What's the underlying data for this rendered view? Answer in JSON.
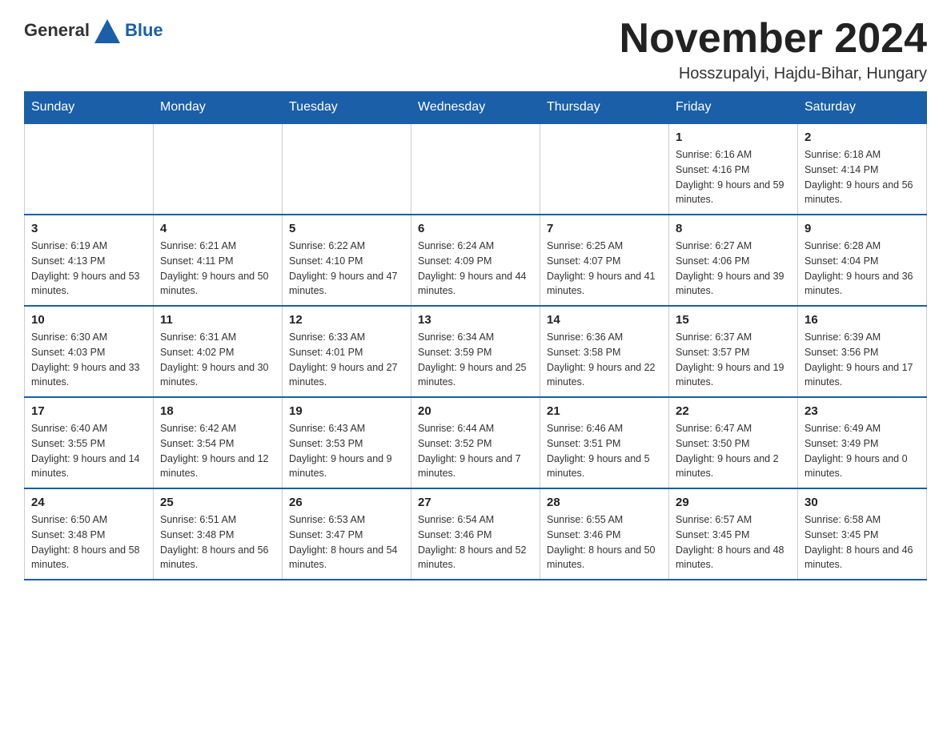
{
  "header": {
    "logo_general": "General",
    "logo_blue": "Blue",
    "month_title": "November 2024",
    "location": "Hosszupalyi, Hajdu-Bihar, Hungary"
  },
  "weekdays": [
    "Sunday",
    "Monday",
    "Tuesday",
    "Wednesday",
    "Thursday",
    "Friday",
    "Saturday"
  ],
  "weeks": [
    [
      {
        "day": "",
        "info": ""
      },
      {
        "day": "",
        "info": ""
      },
      {
        "day": "",
        "info": ""
      },
      {
        "day": "",
        "info": ""
      },
      {
        "day": "",
        "info": ""
      },
      {
        "day": "1",
        "info": "Sunrise: 6:16 AM\nSunset: 4:16 PM\nDaylight: 9 hours and 59 minutes."
      },
      {
        "day": "2",
        "info": "Sunrise: 6:18 AM\nSunset: 4:14 PM\nDaylight: 9 hours and 56 minutes."
      }
    ],
    [
      {
        "day": "3",
        "info": "Sunrise: 6:19 AM\nSunset: 4:13 PM\nDaylight: 9 hours and 53 minutes."
      },
      {
        "day": "4",
        "info": "Sunrise: 6:21 AM\nSunset: 4:11 PM\nDaylight: 9 hours and 50 minutes."
      },
      {
        "day": "5",
        "info": "Sunrise: 6:22 AM\nSunset: 4:10 PM\nDaylight: 9 hours and 47 minutes."
      },
      {
        "day": "6",
        "info": "Sunrise: 6:24 AM\nSunset: 4:09 PM\nDaylight: 9 hours and 44 minutes."
      },
      {
        "day": "7",
        "info": "Sunrise: 6:25 AM\nSunset: 4:07 PM\nDaylight: 9 hours and 41 minutes."
      },
      {
        "day": "8",
        "info": "Sunrise: 6:27 AM\nSunset: 4:06 PM\nDaylight: 9 hours and 39 minutes."
      },
      {
        "day": "9",
        "info": "Sunrise: 6:28 AM\nSunset: 4:04 PM\nDaylight: 9 hours and 36 minutes."
      }
    ],
    [
      {
        "day": "10",
        "info": "Sunrise: 6:30 AM\nSunset: 4:03 PM\nDaylight: 9 hours and 33 minutes."
      },
      {
        "day": "11",
        "info": "Sunrise: 6:31 AM\nSunset: 4:02 PM\nDaylight: 9 hours and 30 minutes."
      },
      {
        "day": "12",
        "info": "Sunrise: 6:33 AM\nSunset: 4:01 PM\nDaylight: 9 hours and 27 minutes."
      },
      {
        "day": "13",
        "info": "Sunrise: 6:34 AM\nSunset: 3:59 PM\nDaylight: 9 hours and 25 minutes."
      },
      {
        "day": "14",
        "info": "Sunrise: 6:36 AM\nSunset: 3:58 PM\nDaylight: 9 hours and 22 minutes."
      },
      {
        "day": "15",
        "info": "Sunrise: 6:37 AM\nSunset: 3:57 PM\nDaylight: 9 hours and 19 minutes."
      },
      {
        "day": "16",
        "info": "Sunrise: 6:39 AM\nSunset: 3:56 PM\nDaylight: 9 hours and 17 minutes."
      }
    ],
    [
      {
        "day": "17",
        "info": "Sunrise: 6:40 AM\nSunset: 3:55 PM\nDaylight: 9 hours and 14 minutes."
      },
      {
        "day": "18",
        "info": "Sunrise: 6:42 AM\nSunset: 3:54 PM\nDaylight: 9 hours and 12 minutes."
      },
      {
        "day": "19",
        "info": "Sunrise: 6:43 AM\nSunset: 3:53 PM\nDaylight: 9 hours and 9 minutes."
      },
      {
        "day": "20",
        "info": "Sunrise: 6:44 AM\nSunset: 3:52 PM\nDaylight: 9 hours and 7 minutes."
      },
      {
        "day": "21",
        "info": "Sunrise: 6:46 AM\nSunset: 3:51 PM\nDaylight: 9 hours and 5 minutes."
      },
      {
        "day": "22",
        "info": "Sunrise: 6:47 AM\nSunset: 3:50 PM\nDaylight: 9 hours and 2 minutes."
      },
      {
        "day": "23",
        "info": "Sunrise: 6:49 AM\nSunset: 3:49 PM\nDaylight: 9 hours and 0 minutes."
      }
    ],
    [
      {
        "day": "24",
        "info": "Sunrise: 6:50 AM\nSunset: 3:48 PM\nDaylight: 8 hours and 58 minutes."
      },
      {
        "day": "25",
        "info": "Sunrise: 6:51 AM\nSunset: 3:48 PM\nDaylight: 8 hours and 56 minutes."
      },
      {
        "day": "26",
        "info": "Sunrise: 6:53 AM\nSunset: 3:47 PM\nDaylight: 8 hours and 54 minutes."
      },
      {
        "day": "27",
        "info": "Sunrise: 6:54 AM\nSunset: 3:46 PM\nDaylight: 8 hours and 52 minutes."
      },
      {
        "day": "28",
        "info": "Sunrise: 6:55 AM\nSunset: 3:46 PM\nDaylight: 8 hours and 50 minutes."
      },
      {
        "day": "29",
        "info": "Sunrise: 6:57 AM\nSunset: 3:45 PM\nDaylight: 8 hours and 48 minutes."
      },
      {
        "day": "30",
        "info": "Sunrise: 6:58 AM\nSunset: 3:45 PM\nDaylight: 8 hours and 46 minutes."
      }
    ]
  ],
  "colors": {
    "header_bg": "#1a5fa8",
    "border": "#1a5fa8"
  }
}
